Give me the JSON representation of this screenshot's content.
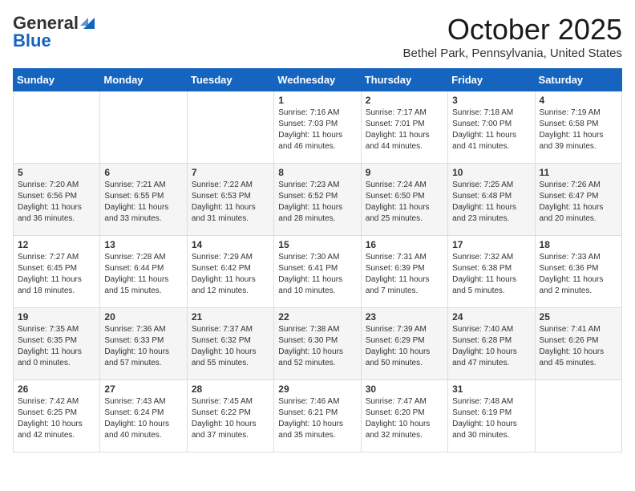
{
  "header": {
    "logo_general": "General",
    "logo_blue": "Blue",
    "month_title": "October 2025",
    "location": "Bethel Park, Pennsylvania, United States"
  },
  "days_of_week": [
    "Sunday",
    "Monday",
    "Tuesday",
    "Wednesday",
    "Thursday",
    "Friday",
    "Saturday"
  ],
  "weeks": [
    [
      {
        "day": "",
        "info": ""
      },
      {
        "day": "",
        "info": ""
      },
      {
        "day": "",
        "info": ""
      },
      {
        "day": "1",
        "info": "Sunrise: 7:16 AM\nSunset: 7:03 PM\nDaylight: 11 hours and 46 minutes."
      },
      {
        "day": "2",
        "info": "Sunrise: 7:17 AM\nSunset: 7:01 PM\nDaylight: 11 hours and 44 minutes."
      },
      {
        "day": "3",
        "info": "Sunrise: 7:18 AM\nSunset: 7:00 PM\nDaylight: 11 hours and 41 minutes."
      },
      {
        "day": "4",
        "info": "Sunrise: 7:19 AM\nSunset: 6:58 PM\nDaylight: 11 hours and 39 minutes."
      }
    ],
    [
      {
        "day": "5",
        "info": "Sunrise: 7:20 AM\nSunset: 6:56 PM\nDaylight: 11 hours and 36 minutes."
      },
      {
        "day": "6",
        "info": "Sunrise: 7:21 AM\nSunset: 6:55 PM\nDaylight: 11 hours and 33 minutes."
      },
      {
        "day": "7",
        "info": "Sunrise: 7:22 AM\nSunset: 6:53 PM\nDaylight: 11 hours and 31 minutes."
      },
      {
        "day": "8",
        "info": "Sunrise: 7:23 AM\nSunset: 6:52 PM\nDaylight: 11 hours and 28 minutes."
      },
      {
        "day": "9",
        "info": "Sunrise: 7:24 AM\nSunset: 6:50 PM\nDaylight: 11 hours and 25 minutes."
      },
      {
        "day": "10",
        "info": "Sunrise: 7:25 AM\nSunset: 6:48 PM\nDaylight: 11 hours and 23 minutes."
      },
      {
        "day": "11",
        "info": "Sunrise: 7:26 AM\nSunset: 6:47 PM\nDaylight: 11 hours and 20 minutes."
      }
    ],
    [
      {
        "day": "12",
        "info": "Sunrise: 7:27 AM\nSunset: 6:45 PM\nDaylight: 11 hours and 18 minutes."
      },
      {
        "day": "13",
        "info": "Sunrise: 7:28 AM\nSunset: 6:44 PM\nDaylight: 11 hours and 15 minutes."
      },
      {
        "day": "14",
        "info": "Sunrise: 7:29 AM\nSunset: 6:42 PM\nDaylight: 11 hours and 12 minutes."
      },
      {
        "day": "15",
        "info": "Sunrise: 7:30 AM\nSunset: 6:41 PM\nDaylight: 11 hours and 10 minutes."
      },
      {
        "day": "16",
        "info": "Sunrise: 7:31 AM\nSunset: 6:39 PM\nDaylight: 11 hours and 7 minutes."
      },
      {
        "day": "17",
        "info": "Sunrise: 7:32 AM\nSunset: 6:38 PM\nDaylight: 11 hours and 5 minutes."
      },
      {
        "day": "18",
        "info": "Sunrise: 7:33 AM\nSunset: 6:36 PM\nDaylight: 11 hours and 2 minutes."
      }
    ],
    [
      {
        "day": "19",
        "info": "Sunrise: 7:35 AM\nSunset: 6:35 PM\nDaylight: 11 hours and 0 minutes."
      },
      {
        "day": "20",
        "info": "Sunrise: 7:36 AM\nSunset: 6:33 PM\nDaylight: 10 hours and 57 minutes."
      },
      {
        "day": "21",
        "info": "Sunrise: 7:37 AM\nSunset: 6:32 PM\nDaylight: 10 hours and 55 minutes."
      },
      {
        "day": "22",
        "info": "Sunrise: 7:38 AM\nSunset: 6:30 PM\nDaylight: 10 hours and 52 minutes."
      },
      {
        "day": "23",
        "info": "Sunrise: 7:39 AM\nSunset: 6:29 PM\nDaylight: 10 hours and 50 minutes."
      },
      {
        "day": "24",
        "info": "Sunrise: 7:40 AM\nSunset: 6:28 PM\nDaylight: 10 hours and 47 minutes."
      },
      {
        "day": "25",
        "info": "Sunrise: 7:41 AM\nSunset: 6:26 PM\nDaylight: 10 hours and 45 minutes."
      }
    ],
    [
      {
        "day": "26",
        "info": "Sunrise: 7:42 AM\nSunset: 6:25 PM\nDaylight: 10 hours and 42 minutes."
      },
      {
        "day": "27",
        "info": "Sunrise: 7:43 AM\nSunset: 6:24 PM\nDaylight: 10 hours and 40 minutes."
      },
      {
        "day": "28",
        "info": "Sunrise: 7:45 AM\nSunset: 6:22 PM\nDaylight: 10 hours and 37 minutes."
      },
      {
        "day": "29",
        "info": "Sunrise: 7:46 AM\nSunset: 6:21 PM\nDaylight: 10 hours and 35 minutes."
      },
      {
        "day": "30",
        "info": "Sunrise: 7:47 AM\nSunset: 6:20 PM\nDaylight: 10 hours and 32 minutes."
      },
      {
        "day": "31",
        "info": "Sunrise: 7:48 AM\nSunset: 6:19 PM\nDaylight: 10 hours and 30 minutes."
      },
      {
        "day": "",
        "info": ""
      }
    ]
  ]
}
